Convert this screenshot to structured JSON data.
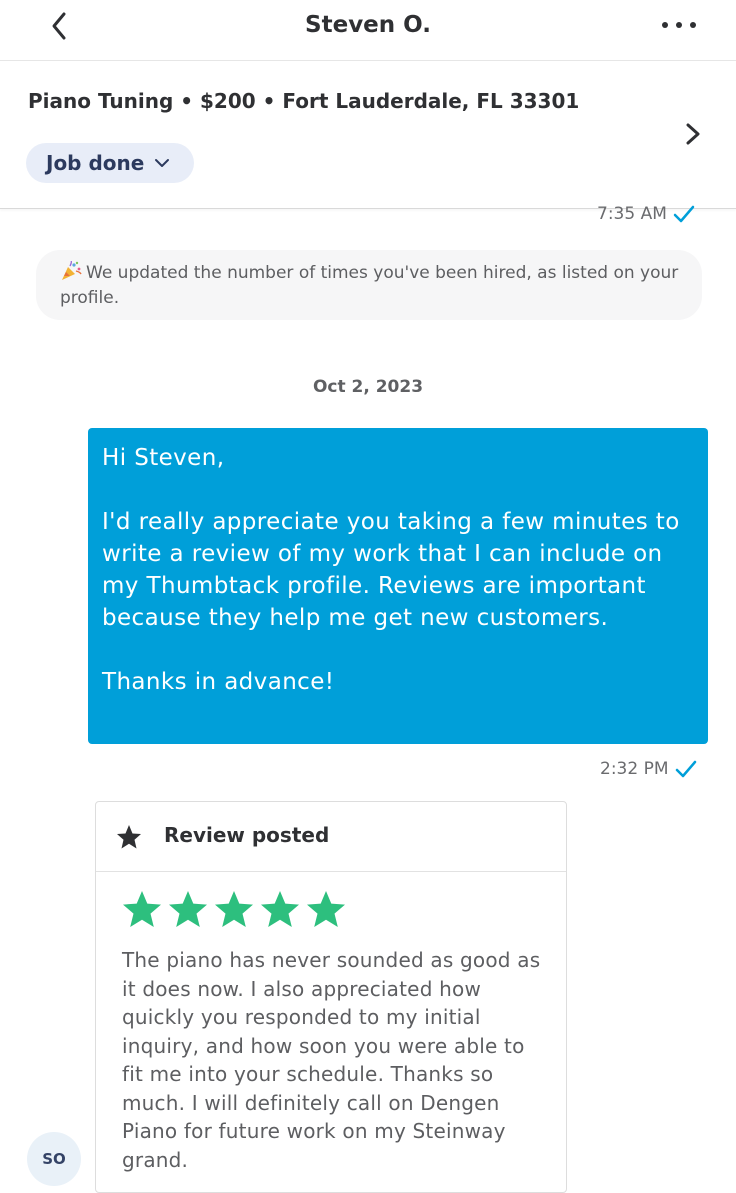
{
  "header": {
    "title": "Steven O.",
    "back_icon": "chevron-left-icon",
    "more_icon": "more-horizontal-icon"
  },
  "job": {
    "summary": "Piano Tuning • $200 • Fort Lauderdale, FL 33301",
    "status": "Job done",
    "status_icon": "chevron-down-icon",
    "details_icon": "chevron-right-icon"
  },
  "messages": {
    "top_timestamp": "7:35 AM",
    "notice": "We updated the number of times you've been hired, as listed on your profile.",
    "notice_icon": "party-popper-icon",
    "date_separator": "Oct 2, 2023",
    "sent": {
      "greeting": "Hi Steven,",
      "body": "I'd really appreciate you taking a few minutes to write a review of my work that I can include on my Thumbtack profile. Reviews are important because they help me get new customers.",
      "closing": "Thanks in advance!",
      "timestamp": "2:32 PM",
      "read_icon": "checkmark-icon"
    },
    "review": {
      "title": "Review posted",
      "rating": 5,
      "max_rating": 5,
      "text": "The piano has never sounded as good as it does now.  I also appreciated how quickly you responded to my initial inquiry, and how soon you were able to fit me into your schedule. Thanks so much.  I will definitely call on Dengen Piano for future work on my Steinway grand.",
      "avatar_initials": "SO"
    }
  },
  "colors": {
    "bubble": "#009fd9",
    "star": "#2dbf7e",
    "check": "#009fd9",
    "pill": "#e8edf8"
  }
}
